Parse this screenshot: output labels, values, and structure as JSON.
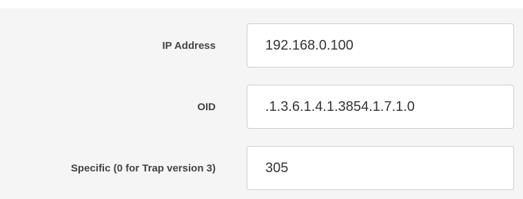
{
  "form": {
    "ip_address": {
      "label": "IP Address",
      "value": "192.168.0.100"
    },
    "oid": {
      "label": "OID",
      "value": ".1.3.6.1.4.1.3854.1.7.1.0"
    },
    "specific": {
      "label": "Specific (0 for Trap version 3)",
      "value": "305"
    }
  }
}
